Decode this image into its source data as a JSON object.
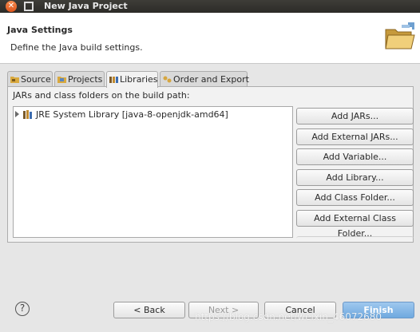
{
  "window": {
    "title": "New Java Project"
  },
  "header": {
    "title": "Java Settings",
    "description": "Define the Java build settings."
  },
  "tabs": [
    {
      "label": "Source",
      "icon": "source-folder-icon",
      "active": false
    },
    {
      "label": "Projects",
      "icon": "projects-icon",
      "active": false
    },
    {
      "label": "Libraries",
      "icon": "libraries-icon",
      "active": true
    },
    {
      "label": "Order and Export",
      "icon": "order-export-icon",
      "active": false
    }
  ],
  "libraries": {
    "label": "JARs and class folders on the build path:",
    "items": [
      {
        "label": "JRE System Library [java-8-openjdk-amd64]",
        "icon": "library-icon"
      }
    ]
  },
  "buttons": {
    "add_jars": "Add JARs...",
    "add_external_jars": "Add External JARs...",
    "add_variable": "Add Variable...",
    "add_library": "Add Library...",
    "add_class_folder": "Add Class Folder...",
    "add_external_class_folder": "Add External Class Folder..."
  },
  "footer": {
    "help": "?",
    "back": "< Back",
    "next": "Next >",
    "cancel": "Cancel",
    "finish": "Finish"
  },
  "watermark": "https://blog.csdn.net/weixin_46072680",
  "colors": {
    "finish_button": "#7fb4e6",
    "title_bar": "#3a3935",
    "close_button": "#e8632a"
  }
}
